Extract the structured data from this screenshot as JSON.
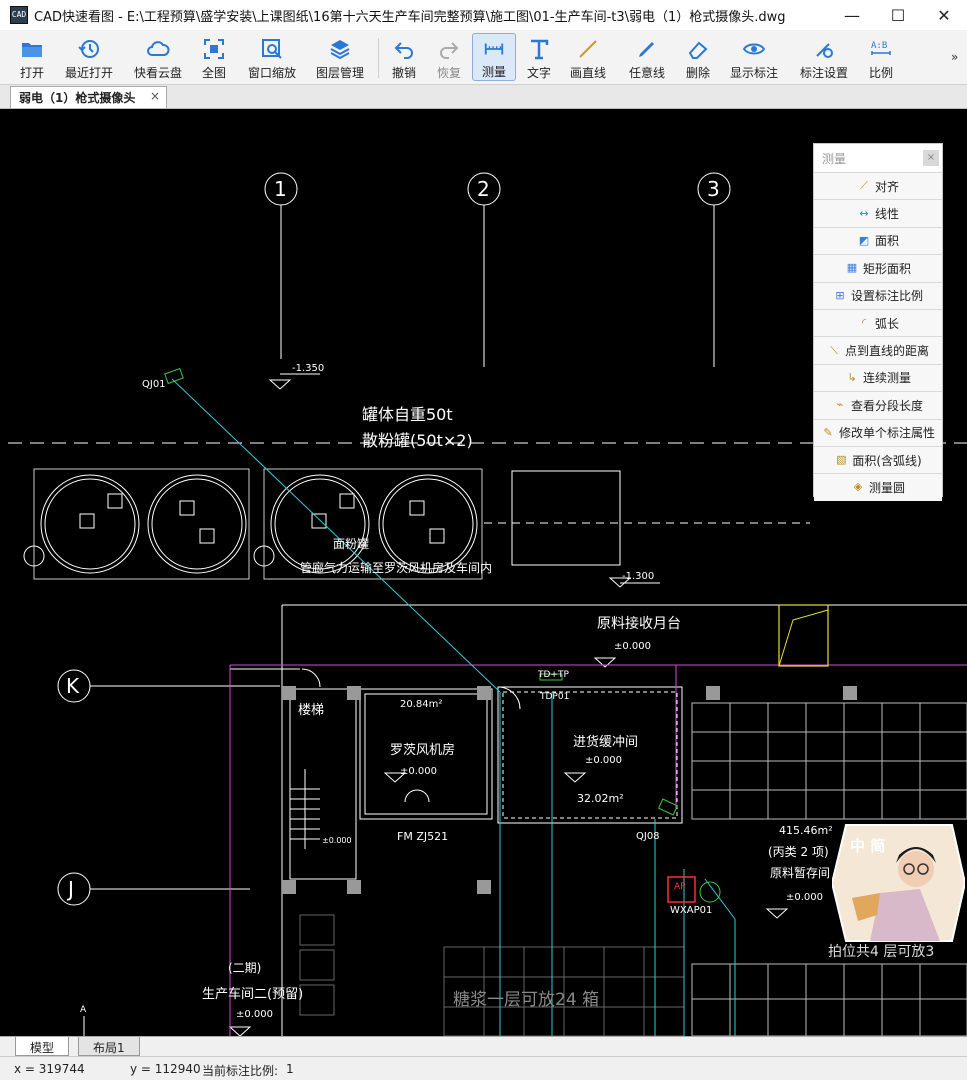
{
  "window": {
    "logo_text": "CAD",
    "title": "CAD快速看图 - E:\\工程预算\\盛学安装\\上课图纸\\16第十六天生产车间完整预算\\施工图\\01-生产车间-t3\\弱电（1）枪式摄像头.dwg",
    "minimize": "—",
    "maximize": "☐",
    "close": "✕"
  },
  "toolbar": {
    "open": "打开",
    "recent": "最近打开",
    "cloud": "快看云盘",
    "fit": "全图",
    "window_zoom": "窗口缩放",
    "layers": "图层管理",
    "undo": "撤销",
    "redo": "恢复",
    "measure": "测量",
    "text": "文字",
    "line": "画直线",
    "freehand": "任意线",
    "delete": "删除",
    "show_dims": "显示标注",
    "dim_settings": "标注设置",
    "scale": "比例",
    "more": "»"
  },
  "tab": {
    "label": "弱电（1）枪式摄像头",
    "close": "×"
  },
  "measure_panel": {
    "title": "测量",
    "close": "×",
    "items": [
      "对齐",
      "线性",
      "面积",
      "矩形面积",
      "设置标注比例",
      "弧长",
      "点到直线的距离",
      "连续测量",
      "查看分段长度",
      "修改单个标注属性",
      "面积(含弧线)",
      "测量圆"
    ]
  },
  "drawing": {
    "grid_axes": [
      "1",
      "2",
      "3",
      "K",
      "J"
    ],
    "texts": {
      "elev_1350": "-1.350",
      "cam1": "QJ01",
      "tank_weight": "罐体自重50t",
      "tank_name": "散粉罐(50t×2)",
      "flour_tank": "面粉罐",
      "pipe_note": "管廊气力运输至罗茨风机房及车间内",
      "elev_1300": "-1.300",
      "platform": "原料接收月台",
      "elev_platform": "±0.000",
      "td": "TD+TP",
      "tdp": "TDP01",
      "stair": "楼梯",
      "area_20": "20.84m²",
      "roots": "罗茨风机房",
      "elev_roots": "±0.000",
      "buffer": "进货缓冲间",
      "elev_buffer": "±0.000",
      "area_32": "32.02m²",
      "fm": "FM  ZJ521",
      "cam8": "QJ08",
      "area_415": "415.46m²",
      "class_c": "(丙类 2 项)",
      "raw_storage": "原料暂存间",
      "elev_storage": "±0.000",
      "ap": "AP",
      "wxap": "WXAP01",
      "pallet": "拍位共4 层可放3",
      "phase2": "(二期)",
      "workshop2": "生产车间二(预留)",
      "elev_ws": "±0.000",
      "stair_elev": "±0.000",
      "sugar": "糖浆一层可放24 箱",
      "north": "A"
    }
  },
  "avatar": {
    "label": "中 简"
  },
  "layout_tabs": {
    "model": "模型",
    "layout1": "布局1"
  },
  "status": {
    "x": "x = 319744",
    "y": "y = 112940",
    "scale_label": "当前标注比例:",
    "scale_value": "1"
  }
}
